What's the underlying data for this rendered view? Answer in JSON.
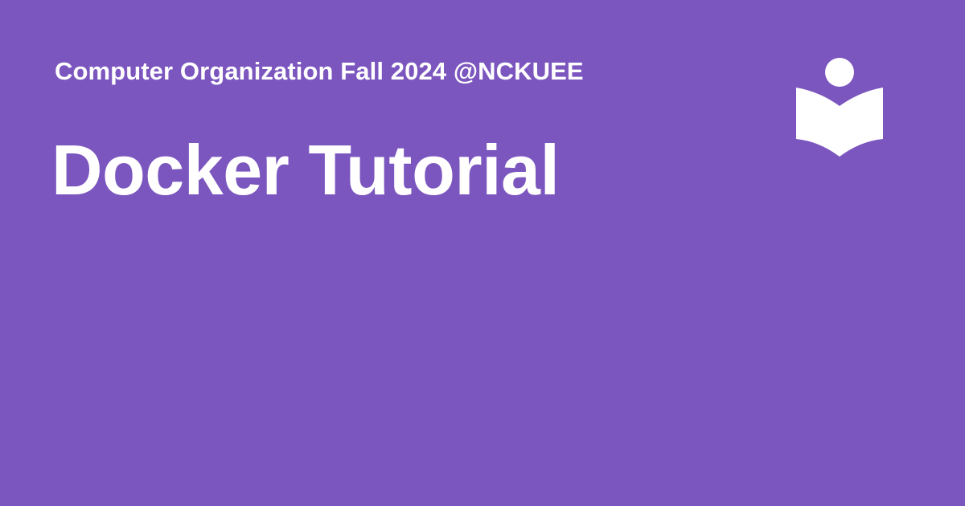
{
  "header": {
    "subtitle": "Computer Organization Fall 2024 @NCKUEE",
    "title": "Docker Tutorial"
  },
  "logo": {
    "icon": "reader-book-icon"
  },
  "colors": {
    "background": "#7c56bf",
    "text": "#ffffff"
  }
}
